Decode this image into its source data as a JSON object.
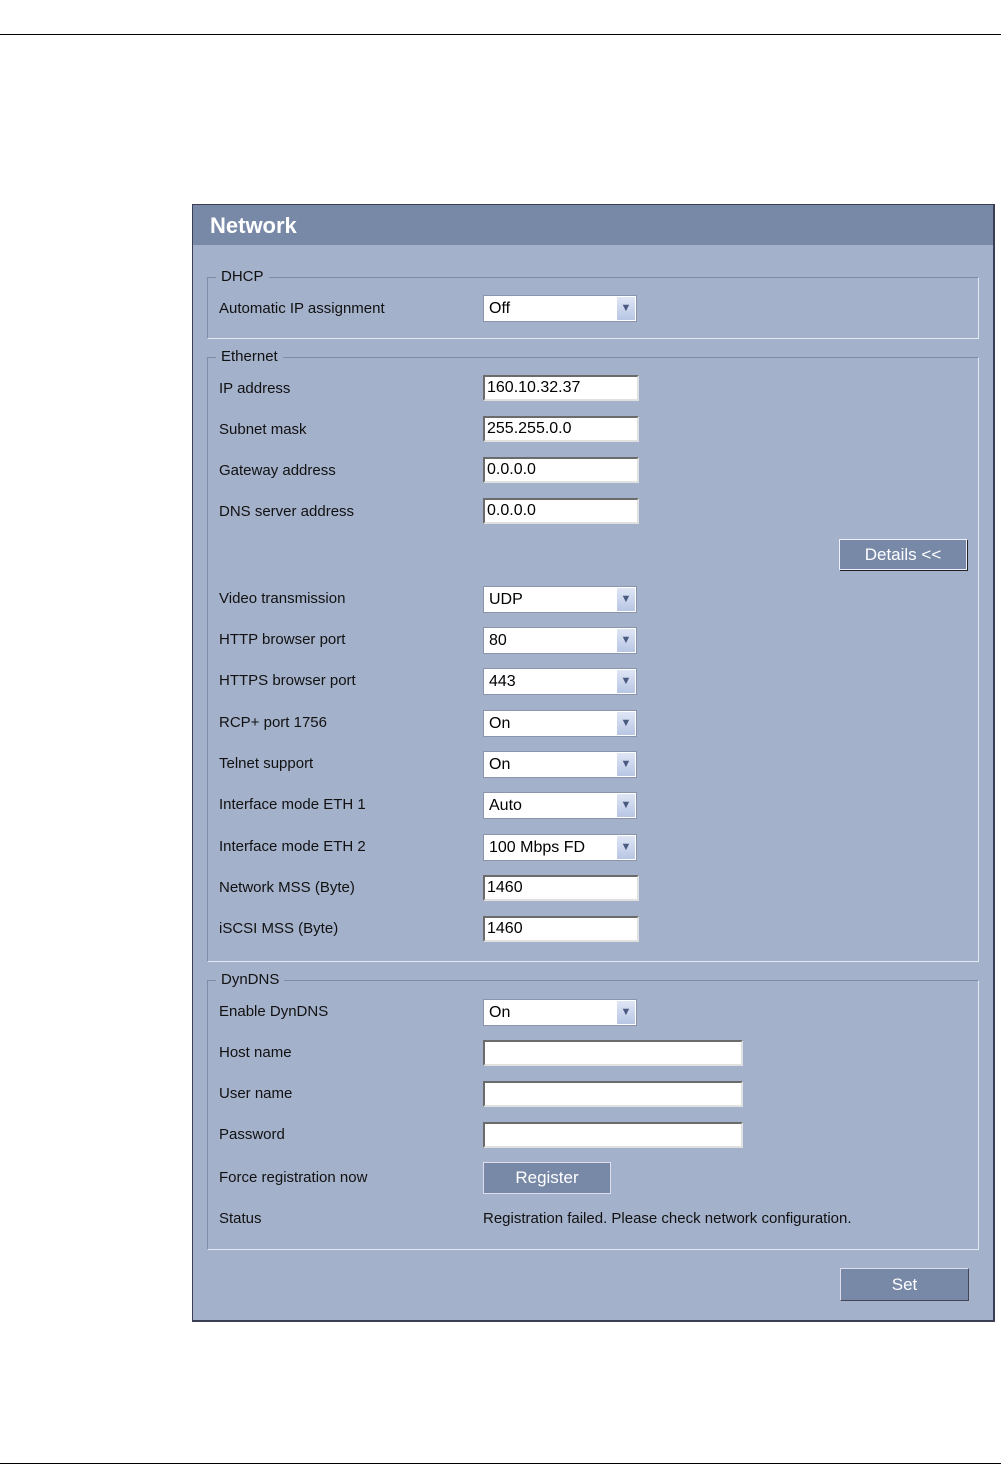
{
  "title": "Network",
  "dhcp": {
    "legend": "DHCP",
    "auto_ip_label": "Automatic IP assignment",
    "auto_ip_value": "Off"
  },
  "ethernet": {
    "legend": "Ethernet",
    "ip_label": "IP address",
    "ip_value": "160.10.32.37",
    "subnet_label": "Subnet mask",
    "subnet_value": "255.255.0.0",
    "gateway_label": "Gateway address",
    "gateway_value": "0.0.0.0",
    "dns_label": "DNS server address",
    "dns_value": "0.0.0.0",
    "details_button": "Details <<",
    "video_label": "Video transmission",
    "video_value": "UDP",
    "http_label": "HTTP browser port",
    "http_value": "80",
    "https_label": "HTTPS browser port",
    "https_value": "443",
    "rcp_label": "RCP+ port 1756",
    "rcp_value": "On",
    "telnet_label": "Telnet support",
    "telnet_value": "On",
    "eth1_label": "Interface mode ETH 1",
    "eth1_value": "Auto",
    "eth2_label": "Interface mode ETH 2",
    "eth2_value": "100 Mbps FD",
    "mss_label": "Network MSS (Byte)",
    "mss_value": "1460",
    "iscsi_label": "iSCSI MSS (Byte)",
    "iscsi_value": "1460"
  },
  "dyndns": {
    "legend": "DynDNS",
    "enable_label": "Enable DynDNS",
    "enable_value": "On",
    "host_label": "Host name",
    "host_value": "",
    "user_label": "User name",
    "user_value": "",
    "password_label": "Password",
    "password_value": "",
    "force_label": "Force registration now",
    "register_button": "Register",
    "status_label": "Status",
    "status_value": "Registration failed. Please check network configuration."
  },
  "set_button": "Set"
}
